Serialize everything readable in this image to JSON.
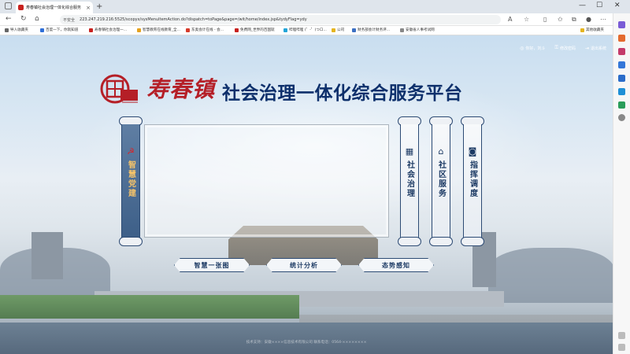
{
  "browser": {
    "tab_title": "寿春镇社会治理一体化综合服务",
    "tab_close": "×",
    "new_tab": "+",
    "insecure_label": "不安全",
    "url": "223.247.219.216:5525/scopyx/sysMenuItemAction.do?dispatch=toPage&page=/wit/home/index.jsp&tydyFlag=ydy",
    "bookmarks": [
      "导入收藏夹",
      "百度一下，你就知道",
      "寿春镇社会治理一...",
      "智慧教育在线教育_全...",
      "东奥会计在线 - 会...",
      "免费网_世界的百国就",
      "哔哩哔哩 (゜-゜)つロ...",
      "公司",
      "财务部会计财务评...",
      "安徽省人事考试网"
    ],
    "other_bookmarks": "其他收藏夹"
  },
  "header": {
    "links": [
      {
        "icon": "user-icon",
        "glyph": "◎",
        "label": "你好，刘斗"
      },
      {
        "icon": "key-icon",
        "glyph": "⚿",
        "label": "修改密码"
      },
      {
        "icon": "logout-icon",
        "glyph": "⇥",
        "label": "退出系统"
      }
    ],
    "title_red": "寿春镇",
    "title_main": "社会治理一体化综合服务平台"
  },
  "panels": [
    {
      "key": "party",
      "icon": "party-emblem-icon",
      "glyph": "☭",
      "label": "智慧党建",
      "active": true
    },
    {
      "key": "governance",
      "icon": "building-icon",
      "glyph": "▦",
      "label": "社会治理",
      "active": false
    },
    {
      "key": "community",
      "icon": "house-icon",
      "glyph": "⌂",
      "label": "社区服务",
      "active": false
    },
    {
      "key": "dispatch",
      "icon": "monitor-icon",
      "glyph": "◙",
      "label": "指挥调度",
      "active": false
    }
  ],
  "buttons": [
    "智慧一张图",
    "统计分析",
    "态势感知"
  ],
  "footer": "技术支持：安徽××××信息技术有限公司    联系电话：0564-××××××××",
  "colors": {
    "brand_red": "#b51f27",
    "navy": "#0d2f6b",
    "scroll_border": "#2d4b74"
  }
}
